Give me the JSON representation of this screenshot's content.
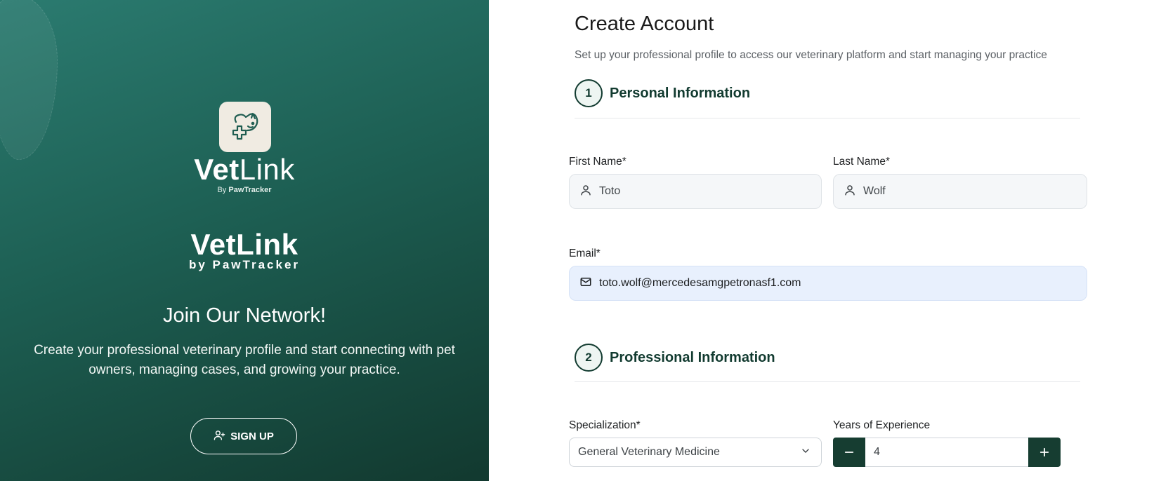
{
  "brand": {
    "name_bold": "Vet",
    "name_light": "Link",
    "sub_prefix": "By ",
    "sub_bold": "PawTracker",
    "wordmark": "VetLink",
    "wordmark_sub": "by PawTracker"
  },
  "left": {
    "heading": "Join Our Network!",
    "description": "Create your professional veterinary profile and start connecting with pet owners, managing cases, and growing your practice.",
    "signup_label": "SIGN UP",
    "signup_icon": "user-plus-icon"
  },
  "form": {
    "title": "Create Account",
    "subtitle": "Set up your professional profile to access our veterinary platform and start managing your practice",
    "sections": [
      {
        "number": "1",
        "label": "Personal Information"
      },
      {
        "number": "2",
        "label": "Professional Information"
      }
    ],
    "first_name": {
      "label": "First Name*",
      "value": "Toto",
      "icon": "user-icon"
    },
    "last_name": {
      "label": "Last Name*",
      "value": "Wolf",
      "icon": "user-icon"
    },
    "email": {
      "label": "Email*",
      "value": "toto.wolf@mercedesamgpetronasf1.com",
      "icon": "mail-icon"
    },
    "specialization": {
      "label": "Specialization*",
      "value": "General Veterinary Medicine"
    },
    "experience": {
      "label": "Years of Experience",
      "value": "4"
    }
  },
  "colors": {
    "primary_dark": "#163d31",
    "panel_gradient_start": "#2b7b70",
    "panel_gradient_end": "#12392f",
    "email_autofill_bg": "#e8f0fd"
  }
}
